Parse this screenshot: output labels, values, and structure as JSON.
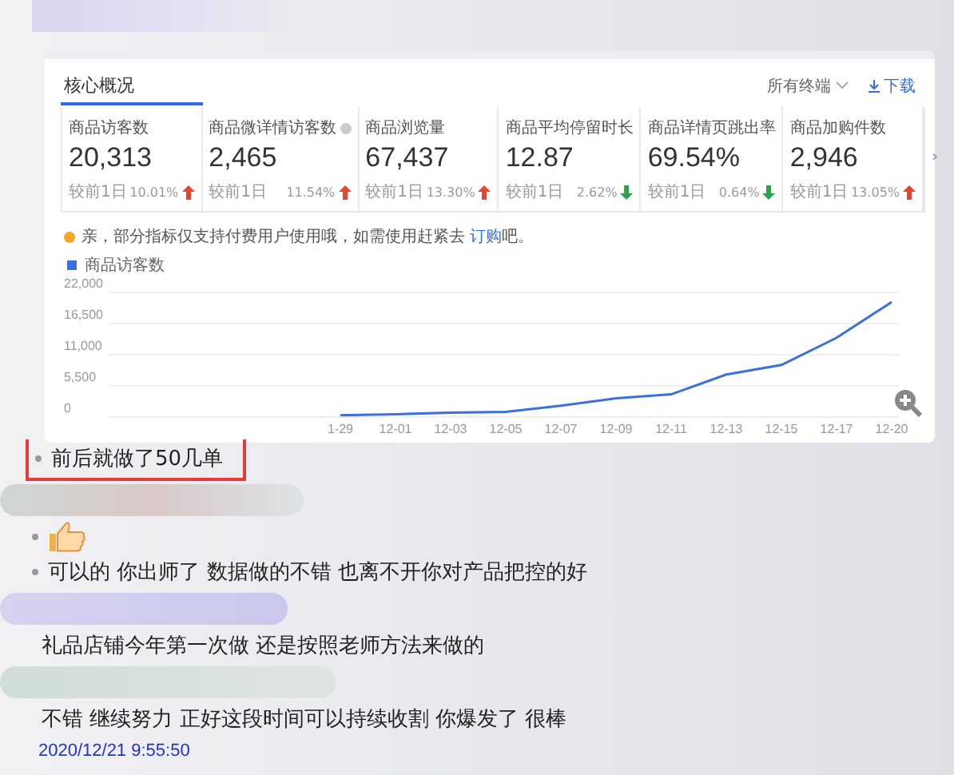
{
  "panel": {
    "title": "核心概况",
    "terminal_filter": "所有终端",
    "download": "下载",
    "metrics": [
      {
        "label": "商品访客数",
        "value": "20,313",
        "compare": "较前1日",
        "change": "10.01%",
        "rising": true,
        "selected": true,
        "info": false
      },
      {
        "label": "商品微详情访客数",
        "value": "2,465",
        "compare": "较前1日",
        "change": "11.54%",
        "rising": true,
        "selected": false,
        "info": true
      },
      {
        "label": "商品浏览量",
        "value": "67,437",
        "compare": "较前1日",
        "change": "13.30%",
        "rising": true,
        "selected": false,
        "info": false
      },
      {
        "label": "商品平均停留时长",
        "value": "12.87",
        "compare": "较前1日",
        "change": "2.62%",
        "rising": false,
        "selected": false,
        "info": false
      },
      {
        "label": "商品详情页跳出率",
        "value": "69.54%",
        "compare": "较前1日",
        "change": "0.64%",
        "rising": false,
        "selected": false,
        "info": false
      },
      {
        "label": "商品加购件数",
        "value": "2,946",
        "compare": "较前1日",
        "change": "13.05%",
        "rising": true,
        "selected": false,
        "info": false
      }
    ],
    "notice": {
      "text": "亲，部分指标仅支持付费用户使用哦，如需使用赶紧去",
      "link": "订购",
      "suffix": "吧。"
    },
    "chart_data": {
      "type": "line",
      "grid": true,
      "categories": [
        "1-29",
        "12-01",
        "12-03",
        "12-05",
        "12-07",
        "12-09",
        "12-11",
        "12-13",
        "12-15",
        "12-17",
        "12-20"
      ],
      "series": [
        {
          "name": "商品访客数",
          "color": "#3b6fe0",
          "values": [
            300,
            500,
            800,
            900,
            2000,
            3300,
            4000,
            7500,
            9200,
            14000,
            20300
          ]
        }
      ],
      "ylim": [
        0,
        22000
      ],
      "yticks": [
        0,
        {
          "value": 5500,
          "label": "5,500"
        },
        {
          "value": 11000,
          "label": "11,000"
        },
        {
          "value": 16500,
          "label": "16,500"
        },
        {
          "value": 22000,
          "label": "22,000"
        }
      ]
    },
    "more": "›"
  },
  "messages": [
    {
      "kind": "text",
      "text": "前后就做了50几单",
      "bullet": true,
      "highlighted": true
    },
    {
      "kind": "redacted"
    },
    {
      "kind": "thumb",
      "bullet": true,
      "highlighted": false
    },
    {
      "kind": "text",
      "text": "可以的  你出师了  数据做的不错  也离不开你对产品把控的好",
      "bullet": true,
      "highlighted": false
    },
    {
      "kind": "redacted"
    },
    {
      "kind": "text",
      "text": "礼品店铺今年第一次做  还是按照老师方法来做的",
      "bullet": false,
      "highlighted": false
    },
    {
      "kind": "redacted"
    },
    {
      "kind": "text",
      "text": "不错  继续努力  正好这段时间可以持续收割  你爆发了  很棒",
      "bullet": false,
      "highlighted": false
    }
  ],
  "timestamp": "2020/12/21 9:55:50"
}
